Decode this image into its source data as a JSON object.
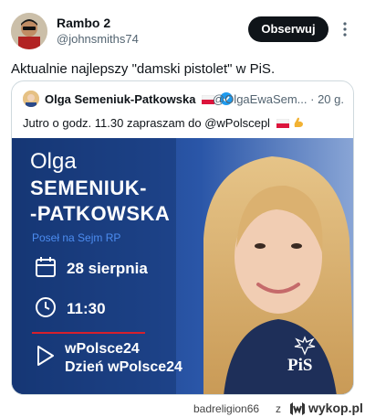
{
  "tweet": {
    "author_name": "Rambo 2",
    "author_handle": "@johnsmiths74",
    "follow_label": "Obserwuj",
    "text": "Aktualnie najlepszy \"damski pistolet\" w PiS."
  },
  "quoted": {
    "author_name": "Olga Semeniuk-Patkowska",
    "author_handle": "@OlgaEwaSem...",
    "time": "· 20 g.",
    "text": "Jutro o godz. 11.30 zapraszam do @wPolscepl",
    "media": {
      "first_name": "Olga",
      "last_name_1": "SEMENIUK-",
      "last_name_2": "-PATKOWSKA",
      "role": "Poseł na Sejm RP",
      "date": "28 sierpnia",
      "time": "11:30",
      "channel_1": "wPolsce24",
      "channel_2": "Dzień wPolsce24",
      "party_logo": "PiS"
    }
  },
  "watermark": {
    "user": "badreligion66",
    "z": "z",
    "site": "wykop.pl"
  },
  "colors": {
    "follow_bg": "#0f1419",
    "media_bg": "#1a3a7a",
    "role_blue": "#4c8cf0",
    "accent_red": "#d6202c",
    "verified": "#1d9bf0"
  }
}
